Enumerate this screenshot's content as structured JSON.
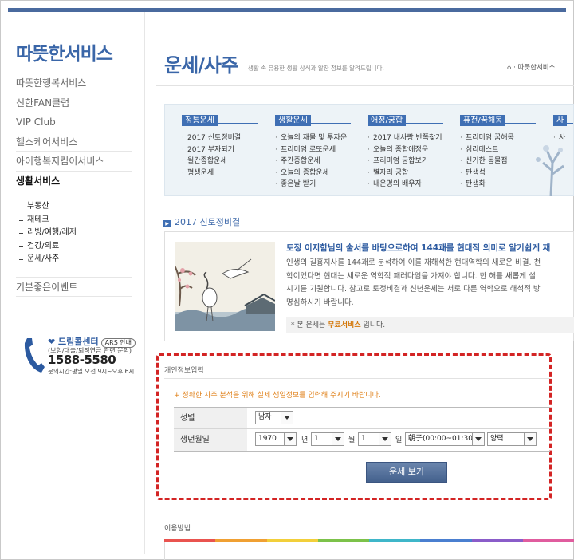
{
  "sidebar": {
    "brand": "따뜻한서비스",
    "items": [
      {
        "label": "따뜻한행복서비스"
      },
      {
        "label": "신한FAN클럽"
      },
      {
        "label": "VIP Club"
      },
      {
        "label": "헬스케어서비스"
      },
      {
        "label": "아이행복지킴이서비스"
      },
      {
        "label": "생활서비스"
      }
    ],
    "subitems": [
      "부동산",
      "재테크",
      "리빙/여행/레저",
      "건강/의료",
      "운세/사주"
    ],
    "event": "기분좋은이벤트"
  },
  "callcenter": {
    "title": "드림콜센터",
    "ars": "ARS 안내",
    "sub": "(보험/대출/퇴직연금 관련 문의)",
    "number": "1588-5580",
    "hours": "문의시간:평일 오전 9시~오후 6시"
  },
  "header": {
    "title": "운세/사주",
    "desc": "생활 속 유용한 생활 상식과 알찬 정보를 알려드립니다.",
    "breadcrumb": "· 따뜻한서비스"
  },
  "categories": [
    {
      "name": "정통운세",
      "items": [
        "2017 신토정비결",
        "2017 부자되기",
        "월간종합운세",
        "평생운세"
      ]
    },
    {
      "name": "생활운세",
      "items": [
        "오늘의 재물 및 투자운",
        "프리미엄 로또운세",
        "주간종합운세",
        "오늘의 종합운세",
        "좋은날 받기"
      ]
    },
    {
      "name": "애정/궁합",
      "items": [
        "2017 내사랑 반쪽찾기",
        "오늘의 종합애정운",
        "프리미엄 궁합보기",
        "별자리 궁합",
        "내운명의 배우자"
      ]
    },
    {
      "name": "퓨전/꿈해몽",
      "items": [
        "프리미엄 꿈해몽",
        "심리테스트",
        "신기한 동물점",
        "탄생석",
        "탄생화"
      ]
    },
    {
      "name": "사",
      "items": [
        "사"
      ]
    }
  ],
  "section": {
    "bullet": "▶",
    "title": "2017 신토정비결",
    "headline": "토정 이지함님의 술서를 바탕으로하여 144괘를 현대적 의미로 알기쉽게 재",
    "body": [
      "인생의 길흉지사를 144괘로 분석하여 이를 재해석한 현대역학의 새로운 비결. 천",
      "학이었다면 현대는 새로운 역학적 패러다임을 가져야 합니다. 한 해를 새롭게 설",
      "시기를 기원합니다. 참고로 토정비결과 신년운세는 서로 다른 역학으로 해석적 방",
      "명심하시기 바랍니다."
    ],
    "note_prefix": "* 본 운세는 ",
    "note_highlight": "무료서비스",
    "note_suffix": " 입니다."
  },
  "form": {
    "label": "개인정보입력",
    "notice": "+ 정확한 사주 분석을 위해 실제 생일정보를 입력해 주시기 바랍니다.",
    "gender_label": "성별",
    "gender_value": "남자",
    "birth_label": "생년월일",
    "year_value": "1970",
    "year_unit": "년",
    "month_value": "1",
    "month_unit": "월",
    "day_value": "1",
    "day_unit": "일",
    "time_value": "朝子(00:00~01:30)",
    "calendar_value": "양력",
    "submit_label": "운세 보기"
  },
  "usage": {
    "title": "이용방법",
    "bar_colors": [
      "#e9534f",
      "#f0a033",
      "#f2cf3a",
      "#7cc24a",
      "#3fb6c9",
      "#4a7fd0",
      "#8a5cc9",
      "#e05c9e"
    ]
  }
}
